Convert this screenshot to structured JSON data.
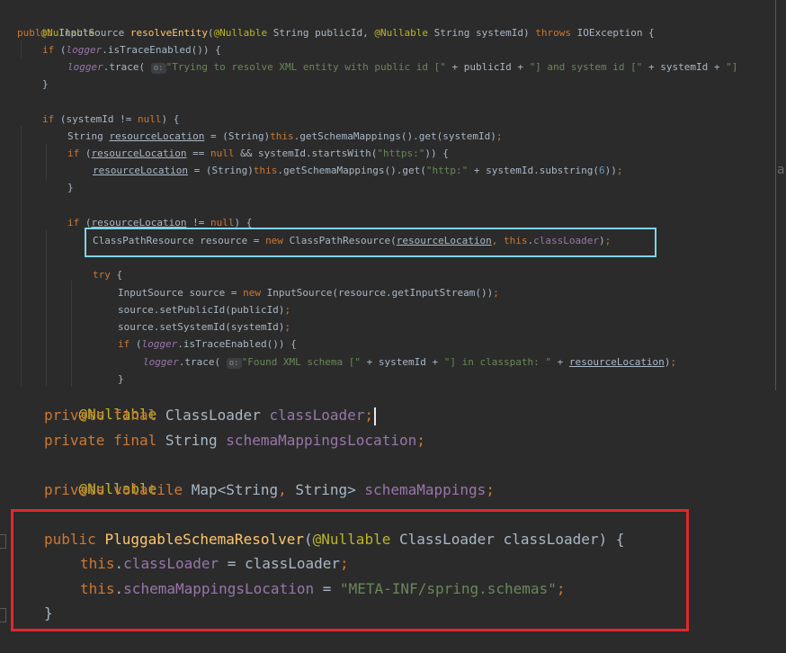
{
  "top_editor": {
    "lines": [
      "@Nullable",
      "public InputSource resolveEntity(@Nullable String publicId, @Nullable String systemId) throws IOException {",
      "if (logger.isTraceEnabled()) {",
      "logger.trace( \"Trying to resolve XML entity with public id [\" + publicId + \"] and system id [\" + systemId + \"]",
      "}",
      "if (systemId != null) {",
      "String resourceLocation = (String)this.getSchemaMappings().get(systemId);",
      "if (resourceLocation == null && systemId.startsWith(\"https:\")) {",
      "resourceLocation = (String)this.getSchemaMappings().get(\"http:\" + systemId.substring(6));",
      "}",
      "if (resourceLocation != null) {",
      "ClassPathResource resource = new ClassPathResource(resourceLocation, this.classLoader);",
      "try {",
      "InputSource source = new InputSource(resource.getInputStream());",
      "source.setPublicId(publicId);",
      "source.setSystemId(systemId);",
      "if (logger.isTraceEnabled()) {",
      "logger.trace( \"Found XML schema [\" + systemId + \"] in classpath: \" + resourceLocation);",
      "}"
    ],
    "param_hint": "o:",
    "right_edge_char": "a"
  },
  "bottom_editor": {
    "lines": [
      "@Nullable",
      "private final ClassLoader classLoader;",
      "private final String schemaMappingsLocation;",
      "@Nullable",
      "private volatile Map<String, String> schemaMappings;",
      "public PluggableSchemaResolver(@Nullable ClassLoader classLoader) {",
      "this.classLoader = classLoader;",
      "this.schemaMappingsLocation = \"META-INF/spring.schemas\";",
      "}"
    ]
  },
  "colors": {
    "background": "#2b2b2b",
    "keyword": "#cc7832",
    "annotation": "#bbb529",
    "method_declaration": "#ffc66d",
    "string": "#6a8759",
    "field": "#9876aa",
    "plain": "#a9b7c6",
    "highlight_cyan": "#7fd3e6",
    "highlight_red": "#e0282e"
  }
}
